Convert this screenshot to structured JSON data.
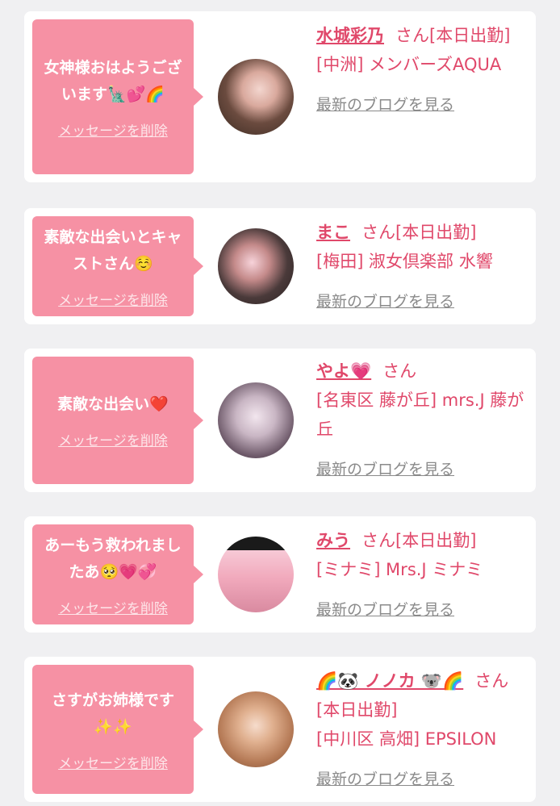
{
  "colors": {
    "background": "#f0f0f2",
    "card": "#ffffff",
    "bubble": "#f691a4",
    "accent_text": "#e0486a",
    "link_gray": "#8a8a8a"
  },
  "cards": [
    {
      "message": "女神様おはようございます🗽💕🌈",
      "delete_label": "メッセージを削除",
      "name": "水城彩乃",
      "suffix": "さん[本日出勤]",
      "shop": "[中洲] メンバーズAQUA",
      "blog_label": "最新のブログを見る"
    },
    {
      "message": "素敵な出会いとキャストさん☺️",
      "delete_label": "メッセージを削除",
      "name": "まこ",
      "suffix": "さん[本日出勤]",
      "shop": "[梅田] 淑女倶楽部 水響",
      "blog_label": "最新のブログを見る"
    },
    {
      "message": "素敵な出会い❤️",
      "delete_label": "メッセージを削除",
      "name": "やよ💗",
      "suffix": "さん",
      "shop": "[名東区 藤が丘] mrs.J 藤が丘",
      "blog_label": "最新のブログを見る"
    },
    {
      "message": "あーもう救われましたあ🥺💗💞",
      "delete_label": "メッセージを削除",
      "name": "みう",
      "suffix": "さん[本日出勤]",
      "shop": "[ミナミ] Mrs.J ミナミ",
      "blog_label": "最新のブログを見る"
    },
    {
      "message": "さすがお姉様です✨✨",
      "delete_label": "メッセージを削除",
      "name": "🌈🐼 ノノカ 🐨🌈",
      "suffix": "さん[本日出勤]",
      "shop": "[中川区 高畑] EPSILON",
      "blog_label": "最新のブログを見る"
    }
  ]
}
